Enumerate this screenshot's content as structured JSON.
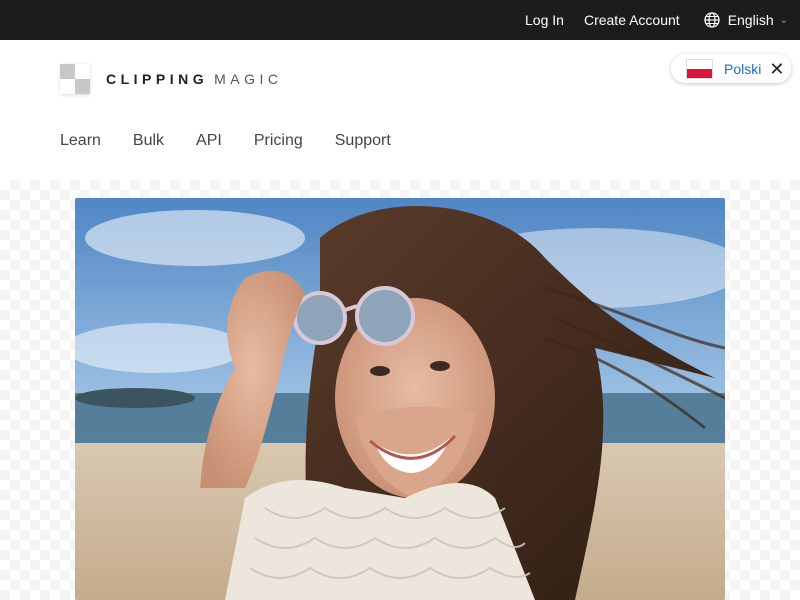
{
  "topbar": {
    "login": "Log In",
    "create_account": "Create Account",
    "language": "English"
  },
  "logo": {
    "bold": "CLIPPING",
    "light": "MAGIC"
  },
  "lang_suggest": {
    "label": "Polski"
  },
  "nav": {
    "items": [
      "Learn",
      "Bulk",
      "API",
      "Pricing",
      "Support"
    ]
  },
  "hero": {
    "alt": "Smiling woman with sunglasses on beach"
  },
  "colors": {
    "topbar": "#1c1c1c",
    "link": "#1a6fc4",
    "flag_red": "#dc143c"
  }
}
